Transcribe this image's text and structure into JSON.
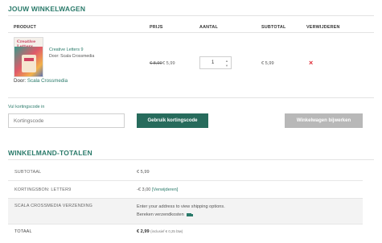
{
  "cart": {
    "title": "JOUW WINKELWAGEN",
    "columns": {
      "product": "PRODUCT",
      "price": "PRIJS",
      "quantity": "AANTAL",
      "subtotal": "SUBTOTAL",
      "remove": "VERWIJDEREN"
    },
    "item": {
      "cover_text": "Creative Letters",
      "name": "Creative Letters 9",
      "door_line": "Door: Scala Crossmedia",
      "door_prefix": "Door:",
      "door_link": "Scala Crossmedia",
      "price_old": "€ 8,99",
      "price_new": "€ 5,99",
      "quantity": "1",
      "subtotal": "€ 5,99",
      "remove_icon": "×"
    },
    "coupon": {
      "label": "Vul kortingscode in",
      "placeholder": "Kortingscode",
      "apply_label": "Gebruik kortingscode",
      "update_label": "Winkelwagen bijwerken"
    }
  },
  "totals": {
    "title": "WINKELMAND-TOTALEN",
    "rows": [
      {
        "label": "SUBTOTAAL",
        "value": "€ 5,99"
      },
      {
        "label": "KORTINGSBON: LETTER9",
        "value_prefix": "-€ 3,00",
        "link": "[Verwijderen]"
      },
      {
        "label": "SCALA CROSSMEDIA VERZENDING",
        "value": "Enter your address to view shipping options.",
        "link": "Bereken verzendkosten",
        "icon": "truck-icon"
      },
      {
        "label": "TOTAAL",
        "value": "€ 2,99",
        "note": "(inclusief € 0,25 btw)"
      }
    ]
  },
  "colors": {
    "accent": "#2a7a6a",
    "button_primary": "#276b5c",
    "button_disabled": "#b8b8b8",
    "remove": "#e0303a"
  }
}
